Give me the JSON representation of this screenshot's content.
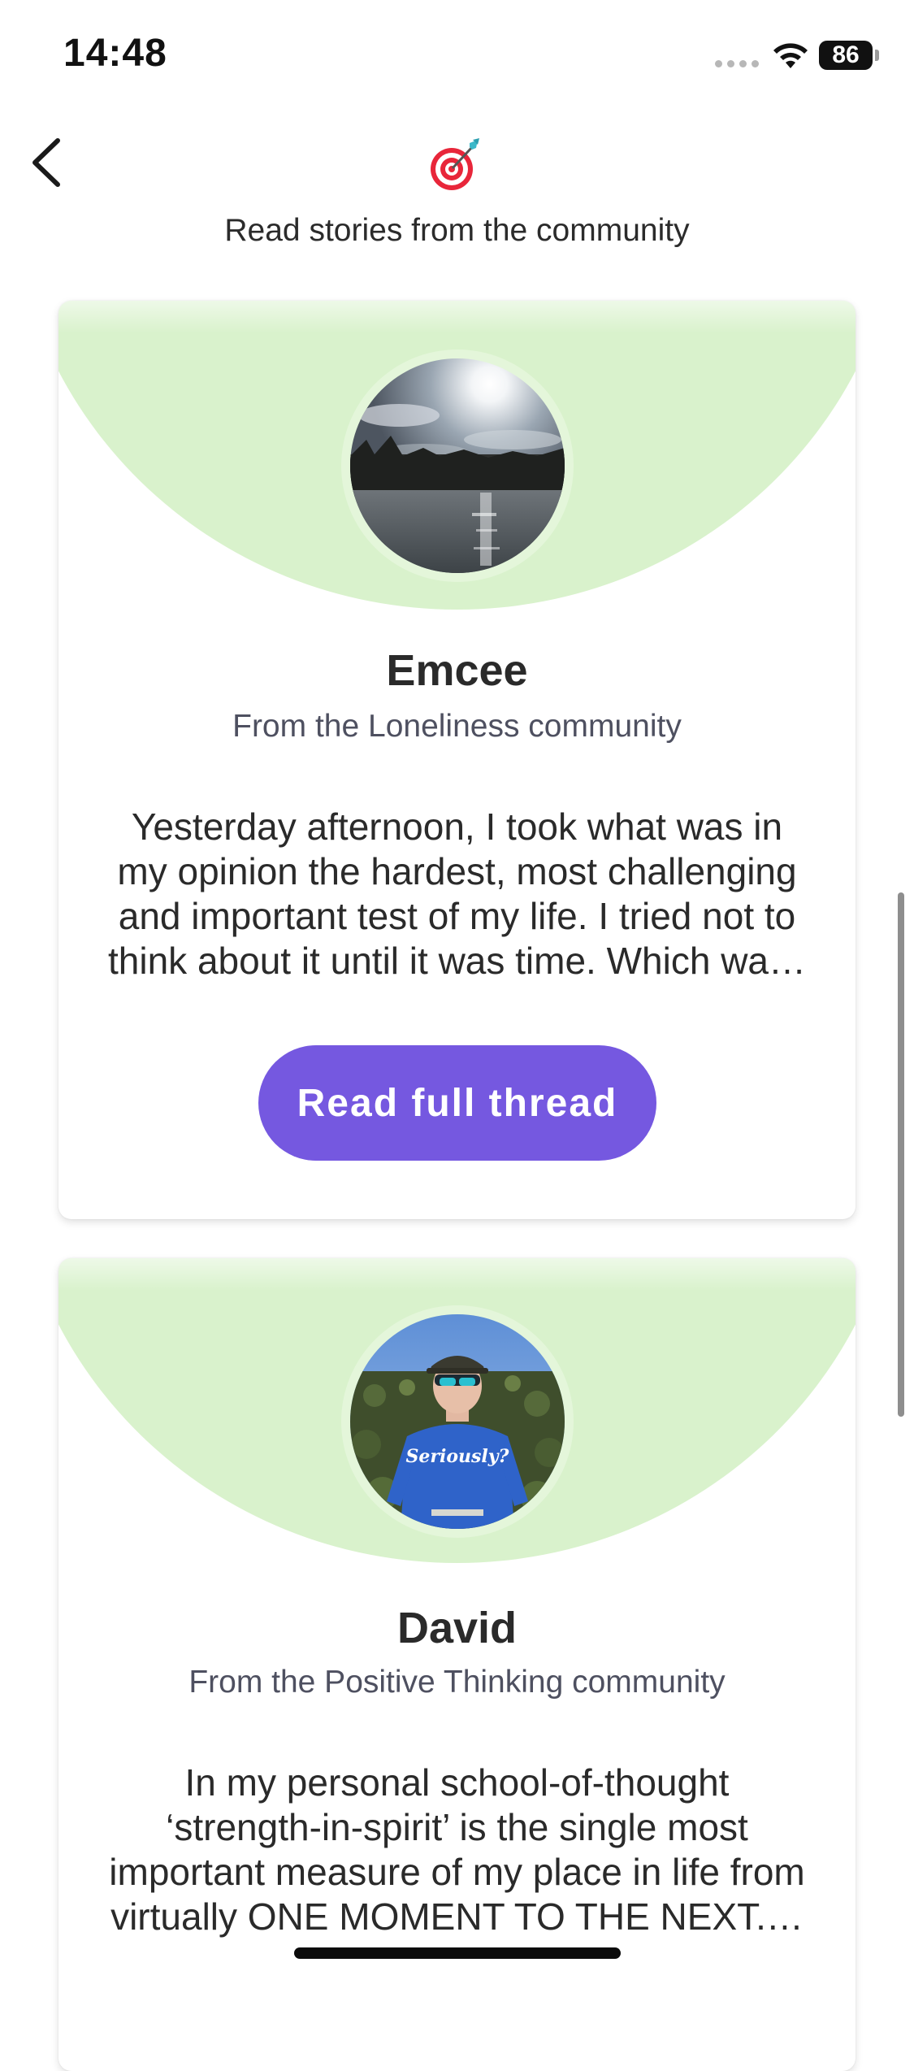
{
  "status_bar": {
    "time": "14:48",
    "battery": "86",
    "icons": [
      "signal-dots-icon",
      "wifi-icon",
      "battery-icon"
    ]
  },
  "header": {
    "back_icon": "chevron-left-icon",
    "logo_icon": "target-dart-icon",
    "subtitle": "Read stories from the community"
  },
  "stories": [
    {
      "name": "Emcee",
      "community": "From the Loneliness community",
      "excerpt_lines": [
        "Yesterday afternoon, I took what was in",
        "my opinion the hardest, most challenging",
        "and important test of my life. I tried not to",
        "think about it until it was time. Which wa…"
      ],
      "button_label": "Read full thread",
      "avatar": "lake-landscape-photo"
    },
    {
      "name": "David",
      "community": "From the Positive Thinking  community",
      "excerpt_lines": [
        "In my personal school-of-thought",
        "‘strength-in-spirit’ is the single most",
        "important measure of my place in life from",
        "virtually ONE MOMENT TO THE NEXT.…"
      ],
      "avatar_text": "Seriously?",
      "avatar": "man-in-field-photo"
    }
  ],
  "colors": {
    "accent": "#7558e0",
    "card_header": "#d9f2cc",
    "avatar_ring": "#e4f6da"
  }
}
